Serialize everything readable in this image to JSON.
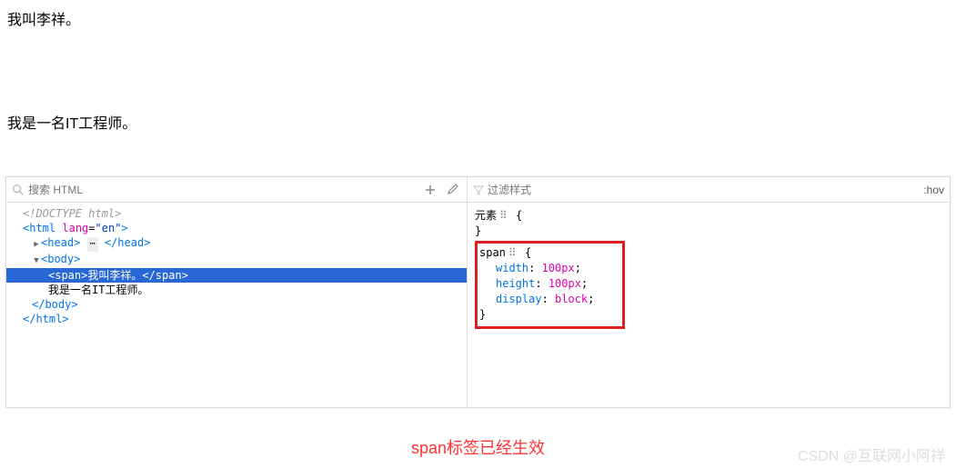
{
  "page": {
    "line1": "我叫李祥。",
    "line2": "我是一名IT工程师。"
  },
  "dom_toolbar": {
    "search_placeholder": "搜索 HTML"
  },
  "styles_toolbar": {
    "filter_placeholder": "过滤样式",
    "hov": ":hov"
  },
  "dom_tree": {
    "doctype": "<!DOCTYPE html>",
    "html_open_1": "<",
    "html_open_tag": "html",
    "html_lang_attr": "lang",
    "html_lang_val": "\"en\"",
    "html_open_2": ">",
    "head_open": "<head>",
    "head_ellipsis": "⋯",
    "head_close": "</head>",
    "body_open": "<body>",
    "span_line": "<span>我叫李祥。</span>",
    "text_node": "我是一名IT工程师。",
    "body_close": "</body>",
    "html_close": "</html>"
  },
  "css": {
    "rule1_selector": "元素",
    "rule1_open": "{",
    "rule1_close": "}",
    "rule2_selector": "span",
    "rule2_open": "{",
    "p1_name": "width",
    "p1_val": "100px",
    "p2_name": "height",
    "p2_val": "100px",
    "p3_name": "display",
    "p3_val": "block",
    "rule2_close": "}"
  },
  "caption": "span标签已经生效",
  "watermark": "CSDN @互联网小阿祥"
}
